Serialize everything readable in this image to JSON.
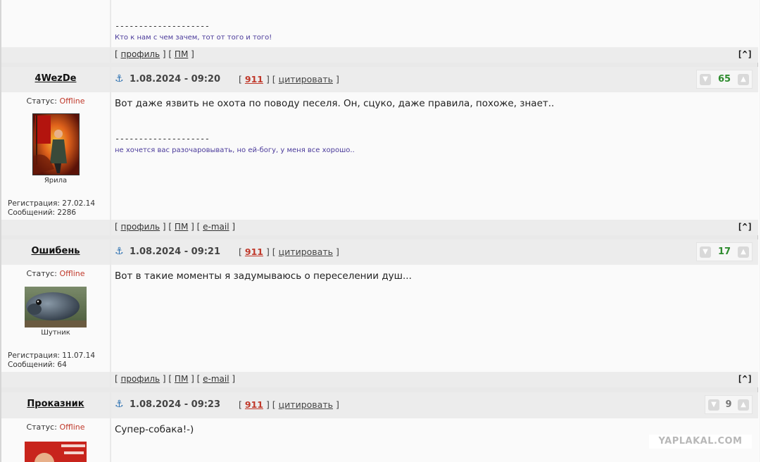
{
  "post0": {
    "sig_dash": "--------------------",
    "sig_text": "Кто к нам с чем зачем, тот от того и того!",
    "footer": {
      "open": "[",
      "profile": "профиль",
      "sep1": "] [",
      "pm": "ПМ",
      "close": "]",
      "top": "[^]"
    }
  },
  "posts": [
    {
      "author": "4WezDe",
      "date": "1.08.2024 - 09:20",
      "num": "911",
      "cite": "цитировать",
      "rating": "65",
      "rating_color": "#2e8b2e",
      "status_label": "Статус:",
      "status_value": "Offline",
      "user_title": "Ярила",
      "reg": "Регистрация: 27.02.14",
      "msgs": "Сообщений: 2286",
      "text": "Вот даже язвить не охота по поводу песеля. Он, сцуко, даже правила, похоже, знает..",
      "sig_dash": "--------------------",
      "sig_text": "не хочется вас разочаровывать, но ей-богу, у меня все хорошо..",
      "footer": {
        "profile": "профиль",
        "pm": "ПМ",
        "email": "e-mail",
        "top": "[^]"
      }
    },
    {
      "author": "Ошибень",
      "date": "1.08.2024 - 09:21",
      "num": "911",
      "cite": "цитировать",
      "rating": "17",
      "rating_color": "#2e8b2e",
      "status_label": "Статус:",
      "status_value": "Offline",
      "user_title": "Шутник",
      "reg": "Регистрация: 11.07.14",
      "msgs": "Сообщений: 64",
      "text": "Вот в такие моменты я задумываюсь о переселении душ...",
      "footer": {
        "profile": "профиль",
        "pm": "ПМ",
        "email": "e-mail",
        "top": "[^]"
      }
    },
    {
      "author": "Проказник",
      "date": "1.08.2024 - 09:23",
      "num": "911",
      "cite": "цитировать",
      "rating": "9",
      "rating_color": "#777777",
      "status_label": "Статус:",
      "status_value": "Offline",
      "text": "Супер-собака!-)"
    }
  ],
  "watermark": "YAPLAKAL.COM"
}
